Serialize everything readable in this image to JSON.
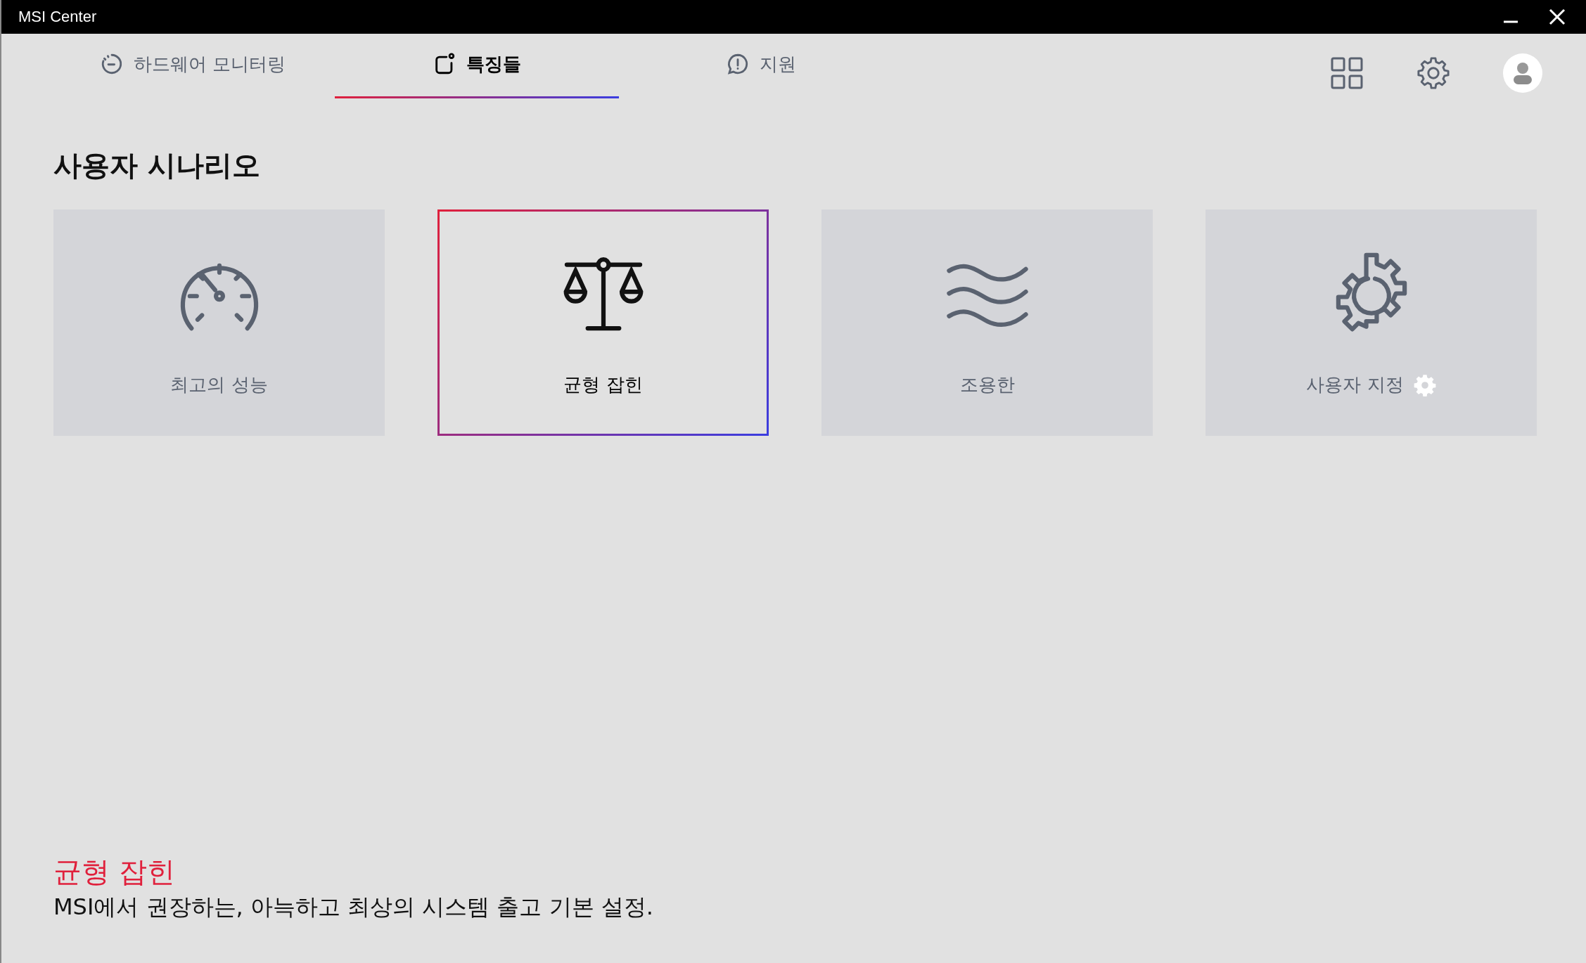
{
  "window": {
    "title": "MSI Center"
  },
  "tabs": [
    {
      "label": "하드웨어 모니터링",
      "kind": "monitor",
      "selected": false
    },
    {
      "label": "특징들",
      "kind": "features",
      "selected": true
    },
    {
      "label": "지원",
      "kind": "support",
      "selected": false
    }
  ],
  "section": {
    "title": "사용자 시나리오"
  },
  "scenarios": [
    {
      "label": "최고의 성능",
      "kind": "speed",
      "selected": false
    },
    {
      "label": "균형 잡힌",
      "kind": "balance",
      "selected": true
    },
    {
      "label": "조용한",
      "kind": "silent",
      "selected": false
    },
    {
      "label": "사용자 지정",
      "kind": "custom",
      "selected": false
    }
  ],
  "description": {
    "title": "균형 잡힌",
    "text": "MSI에서 권장하는, 아늑하고 최상의 시스템 출고 기본 설정."
  }
}
